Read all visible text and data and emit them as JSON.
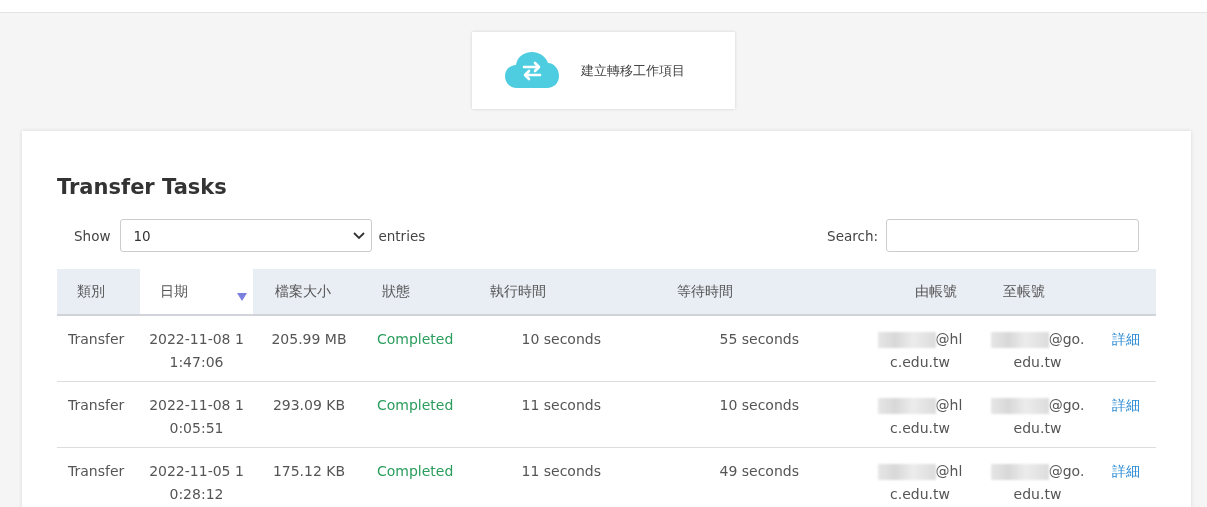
{
  "create_button": {
    "label": "建立轉移工作項目"
  },
  "title": "Transfer Tasks",
  "length_control": {
    "show_label": "Show",
    "value": "10",
    "entries_label": "entries"
  },
  "search": {
    "label": "Search:"
  },
  "table": {
    "columns": [
      {
        "label": "類別",
        "sorted": false
      },
      {
        "label": "日期",
        "sorted": true
      },
      {
        "label": "檔案大小",
        "sorted": false
      },
      {
        "label": "狀態",
        "sorted": false
      },
      {
        "label": "執行時間",
        "sorted": false
      },
      {
        "label": "等待時間",
        "sorted": false
      },
      {
        "label": "由帳號",
        "sorted": false
      },
      {
        "label": "至帳號",
        "sorted": false
      }
    ],
    "rows": [
      {
        "type": "Transfer",
        "date": "2022-11-08 11:47:06",
        "size": "205.99 MB",
        "status": "Completed",
        "run_time": "10 seconds",
        "wait_time": "55 seconds",
        "from_account": [
          "@hl",
          "c.edu.tw"
        ],
        "to_account": [
          "@go.",
          "edu.tw"
        ],
        "detail_link": "詳細"
      },
      {
        "type": "Transfer",
        "date": "2022-11-08 10:05:51",
        "size": "293.09 KB",
        "status": "Completed",
        "run_time": "11 seconds",
        "wait_time": "10 seconds",
        "from_account": [
          "@hl",
          "c.edu.tw"
        ],
        "to_account": [
          "@go.",
          "edu.tw"
        ],
        "detail_link": "詳細"
      },
      {
        "type": "Transfer",
        "date": "2022-11-05 10:28:12",
        "size": "175.12 KB",
        "status": "Completed",
        "run_time": "11 seconds",
        "wait_time": "49 seconds",
        "from_account": [
          "@hl",
          "c.edu.tw"
        ],
        "to_account": [
          "@go.",
          "edu.tw"
        ],
        "detail_link": "詳細"
      }
    ]
  }
}
